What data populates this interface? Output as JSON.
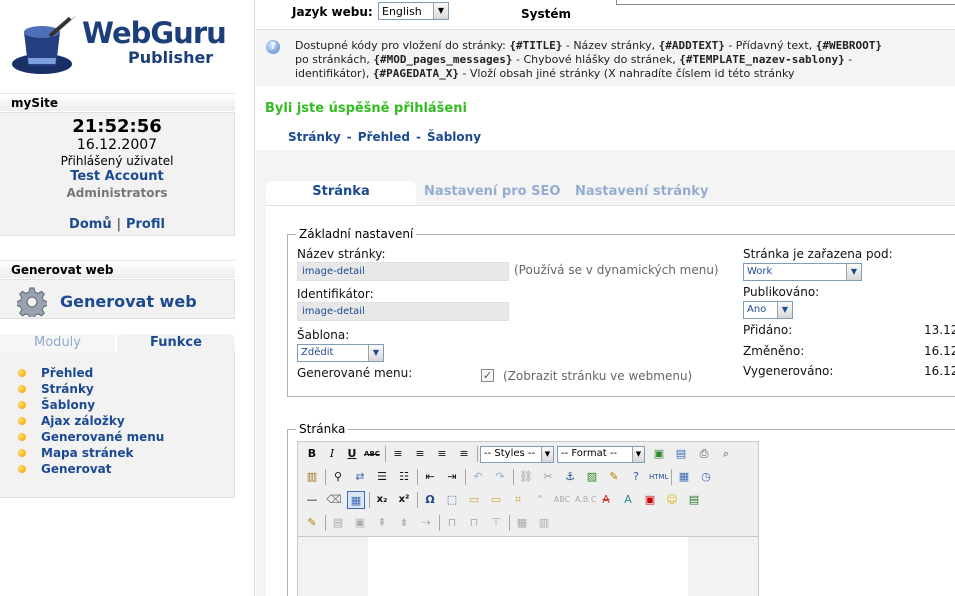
{
  "brand": {
    "line1": "WebGuru",
    "line2": "Publisher"
  },
  "mysite": {
    "title": "mySite",
    "time": "21:52:56",
    "date": "16.12.2007",
    "logged_label": "Přihlášený uživatel",
    "user": "Test Account",
    "role": "Administrators",
    "home_link": "Domů",
    "separator": "|",
    "profile_link": "Profil"
  },
  "generate": {
    "title": "Generovat web",
    "button": "Generovat web",
    "icon": "gear-icon"
  },
  "side_tabs": {
    "modules": "Moduly",
    "functions": "Funkce"
  },
  "side_menu": [
    "Přehled",
    "Stránky",
    "Šablony",
    "Ajax záložky",
    "Generované menu",
    "Mapa stránek",
    "Generovat"
  ],
  "topbar": {
    "lang_label": "Jazyk webu:",
    "lang_value": "English",
    "system_label": "Systém"
  },
  "info": {
    "line1_a": "Dostupné kódy pro vložení do stránky: ",
    "code_title": "{#TITLE}",
    "line1_b": " - Název stránky, ",
    "code_addtext": "{#ADDTEXT}",
    "line1_c": " - Přídavný text, ",
    "code_webroot": "{#WEBROOT}",
    "line2_a": "po stránkách, ",
    "code_mod": "{#MOD_pages_messages}",
    "line2_b": " - Chybové hlášky do stránek, ",
    "code_tpl": "{#TEMPLATE_nazev-sablony}",
    "line2_c": " -",
    "line3_a": "identifikátor), ",
    "code_pagedata": "{#PAGEDATA_X}",
    "line3_b": " - Vloží obsah jiné stránky (X nahradíte číslem id této stránky"
  },
  "success_msg": "Byli jste úspěšně přihlášeni",
  "breadcrumb": {
    "pages": "Stránky",
    "overview": "Přehled",
    "templates": "Šablony",
    "sep": "-"
  },
  "content_tabs": [
    "Stránka",
    "Nastavení pro SEO",
    "Nastavení stránky"
  ],
  "basic": {
    "legend": "Základní nastavení",
    "name_label": "Název stránky:",
    "name_value": "image-detail",
    "name_hint": "(Používá se v dynamických menu)",
    "id_label": "Identifikátor:",
    "id_value": "image-detail",
    "template_label": "Šablona:",
    "template_value": "Zdědit",
    "menu_label": "Generované menu:",
    "menu_check_hint": "(Zobrazit stránku ve webmenu)",
    "menu_checked": true,
    "parent_label": "Stránka je zařazena pod:",
    "parent_value": "Work",
    "published_label": "Publikováno:",
    "published_value": "Ano",
    "added_label": "Přidáno:",
    "added_value": "13.12",
    "changed_label": "Změněno:",
    "changed_value": "16.12",
    "generated_label": "Vygenerováno:",
    "generated_value": "16.12"
  },
  "page_section": {
    "legend": "Stránka",
    "styles": "-- Styles --",
    "format": "-- Format --"
  }
}
